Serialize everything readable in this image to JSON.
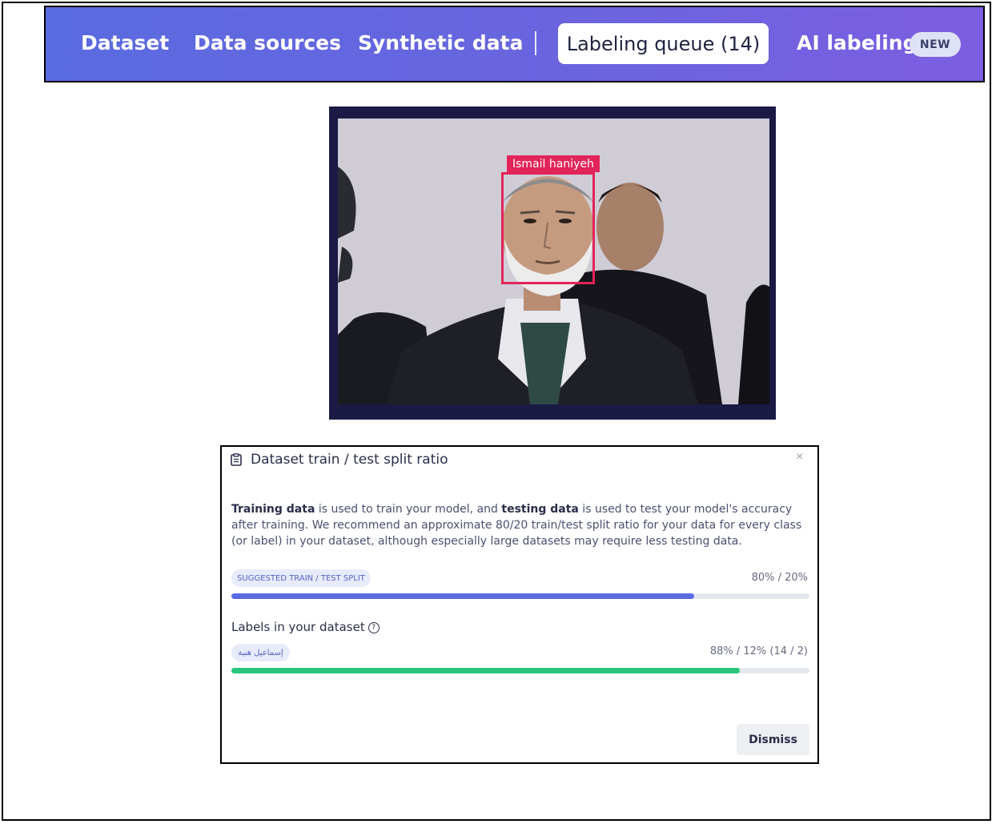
{
  "nav": {
    "items": [
      "Dataset",
      "Data sources",
      "Synthetic data"
    ],
    "active": "Labeling queue (14)",
    "ai_labeling": "AI labeling",
    "badge": "NEW",
    "colors": {
      "bar_start": "#5a6be0",
      "bar_end": "#7c5ee0"
    }
  },
  "image": {
    "box_label": "Ismail haniyeh",
    "box_color": "#e2245a"
  },
  "dialog": {
    "title": "Dataset train / test split ratio",
    "close": "×",
    "body_part1_bold": "Training data",
    "body_part2": " is used to train your model, and ",
    "body_part3_bold": "testing data",
    "body_part4": " is used to test your model's accuracy after training. We recommend an approximate 80/20 train/test split ratio for your data for every class (or label) in your dataset, although especially large datasets may require less testing data.",
    "suggested_pill": "SUGGESTED TRAIN / TEST SPLIT",
    "suggested_ratio": "80% / 20%",
    "suggested_fraction": 0.8,
    "labels_heading": "Labels in your dataset",
    "label_pill": "إسماعيل هنية",
    "label_ratio": "88% / 12% (14 / 2)",
    "label_fraction": 0.88,
    "dismiss": "Dismiss",
    "colors": {
      "suggested_bar": "#5b6be1",
      "label_bar": "#28c77b"
    }
  }
}
